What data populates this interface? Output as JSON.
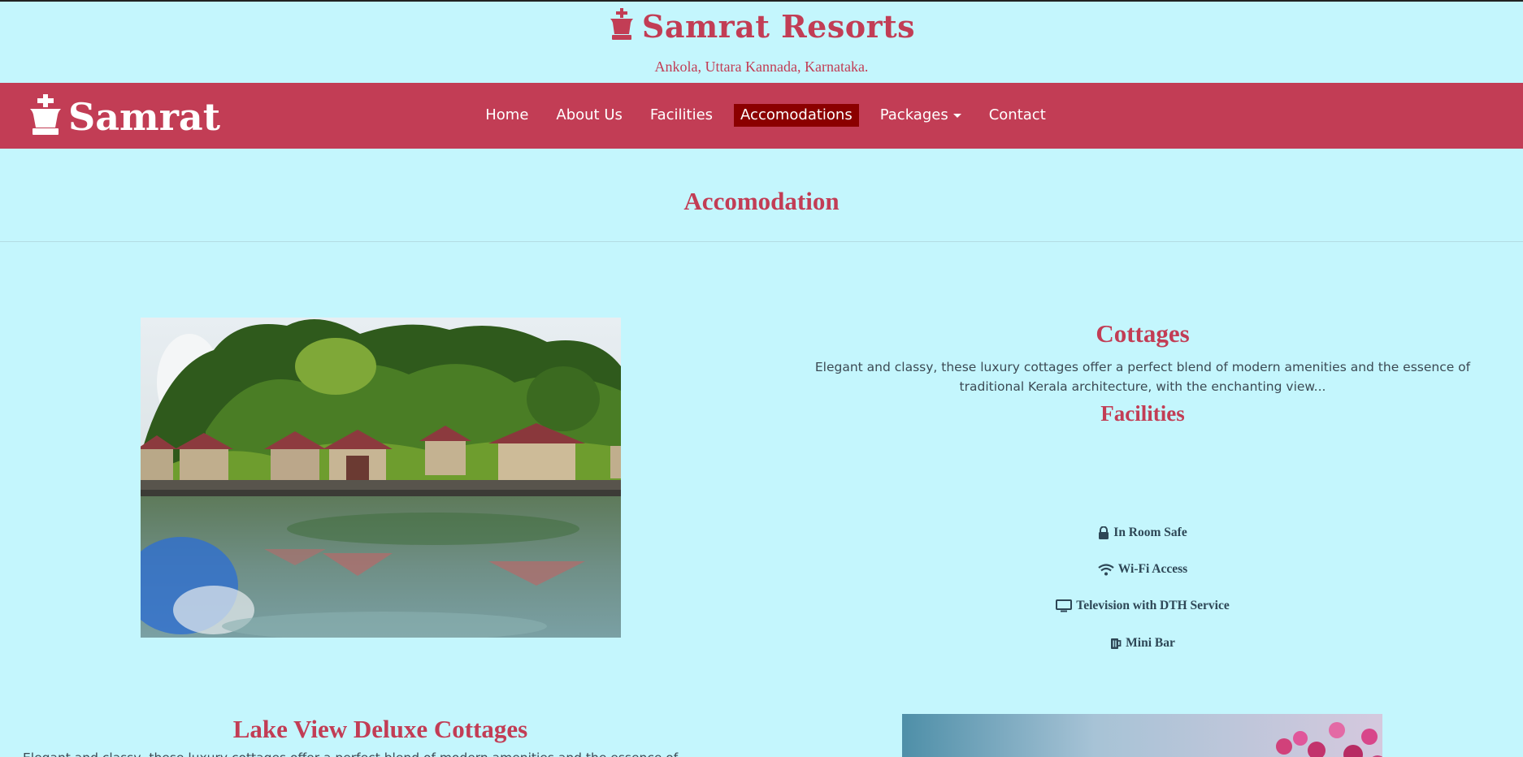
{
  "site": {
    "title": "Samrat Resorts",
    "tagline": "Ankola, Uttara Kannada, Karnataka."
  },
  "navbar": {
    "brand": "Samrat",
    "items": [
      {
        "label": "Home"
      },
      {
        "label": "About Us"
      },
      {
        "label": "Facilities"
      },
      {
        "label": "Accomodations",
        "active": true
      },
      {
        "label": "Packages",
        "dropdown": true
      },
      {
        "label": "Contact"
      }
    ]
  },
  "page": {
    "heading": "Accomodation"
  },
  "rooms": [
    {
      "title": "Cottages",
      "description": "Elegant and classy, these luxury cottages offer a perfect blend of modern amenities and the essence of traditional Kerala architecture, with the enchanting view...",
      "facilities_title": "Facilities",
      "facilities": [
        {
          "icon": "lock-icon",
          "label": "In Room Safe"
        },
        {
          "icon": "wifi-icon",
          "label": "Wi-Fi Access"
        },
        {
          "icon": "tv-icon",
          "label": "Television with DTH Service"
        },
        {
          "icon": "mug-icon",
          "label": "Mini Bar"
        }
      ]
    },
    {
      "title": "Lake View Deluxe Cottages",
      "description": "Elegant and classy, these luxury cottages offer a perfect blend of modern amenities and the essence of traditional Kerala"
    }
  ],
  "colors": {
    "background": "#c4f6fd",
    "brand": "#c23d55",
    "active_nav": "#8b0000"
  }
}
